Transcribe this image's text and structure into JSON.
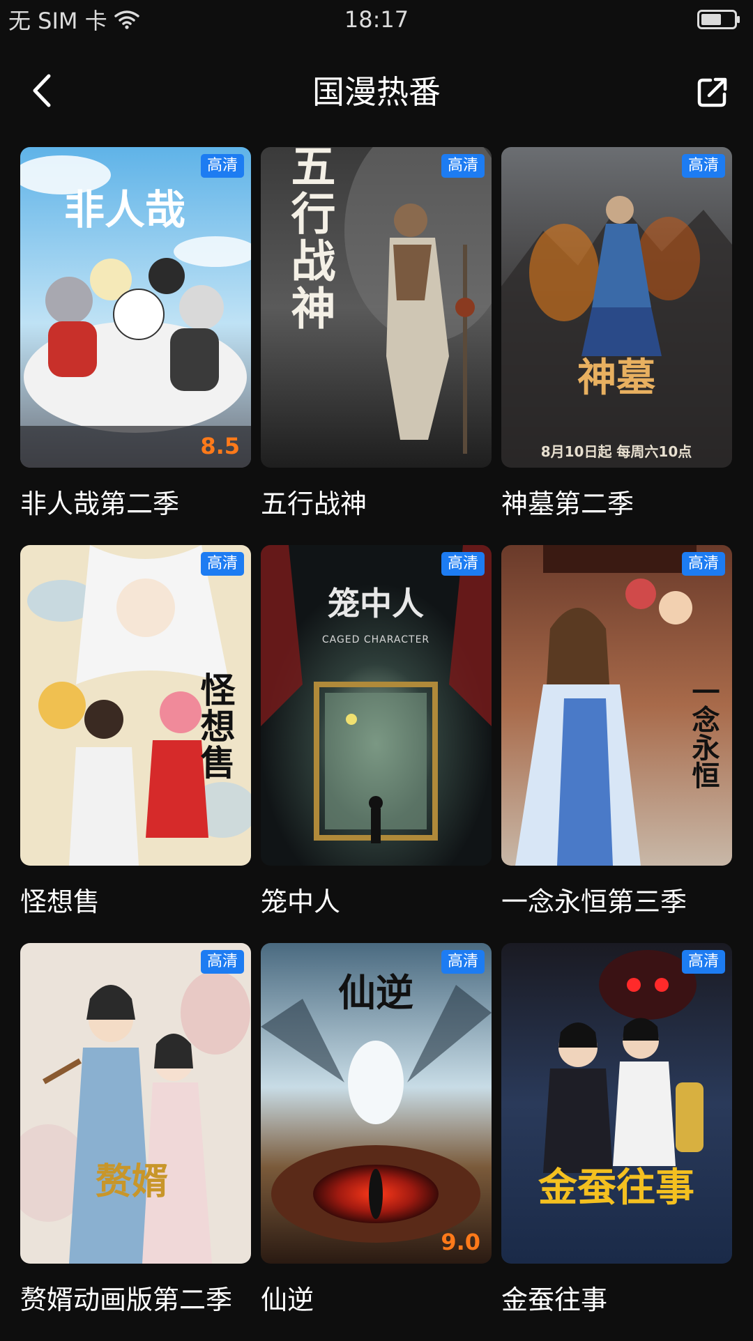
{
  "status_bar": {
    "carrier": "无 SIM 卡",
    "time": "18:17"
  },
  "nav": {
    "title": "国漫热番"
  },
  "colors": {
    "background": "#0e0e0e",
    "badge": "#1d7cf2",
    "score": "#ff7a1a"
  },
  "items": [
    {
      "title": "非人哉第二季",
      "badge": "高清",
      "score": "8.5",
      "poster_text": "非人哉"
    },
    {
      "title": "五行战神",
      "badge": "高清",
      "score": "",
      "poster_text": "五行战神"
    },
    {
      "title": "神墓第二季",
      "badge": "高清",
      "score": "",
      "poster_text": "神墓",
      "poster_subtext": "8月10日起 每周六10点"
    },
    {
      "title": "怪想售",
      "badge": "高清",
      "score": "",
      "poster_text": "怪想售"
    },
    {
      "title": "笼中人",
      "badge": "高清",
      "score": "",
      "poster_text": "笼中人",
      "poster_subtext": "CAGED CHARACTER"
    },
    {
      "title": "一念永恒第三季",
      "badge": "高清",
      "score": "",
      "poster_text": "一念永恒"
    },
    {
      "title": "赘婿动画版第二季",
      "badge": "高清",
      "score": "",
      "poster_text": "赘婿"
    },
    {
      "title": "仙逆",
      "badge": "高清",
      "score": "9.0",
      "poster_text": "仙逆"
    },
    {
      "title": "金蚕往事",
      "badge": "高清",
      "score": "",
      "poster_text": "金蚕往事"
    }
  ]
}
